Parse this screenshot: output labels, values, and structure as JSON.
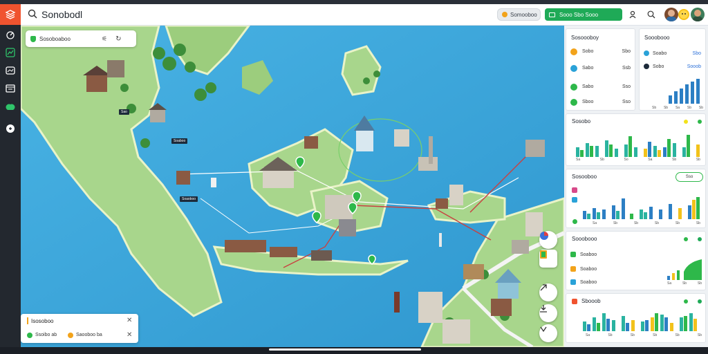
{
  "app": {
    "title": "Sonobodl"
  },
  "topbar": {
    "pill_secondary_label": "Somooboo",
    "pill_primary_label": "Sooo Sbo Sooo"
  },
  "map": {
    "search_placeholder": "Sosoboaboo",
    "card": {
      "title": "Isosoboo",
      "row_1": "Ssoibo ab",
      "row_2": "Saooboo ba"
    },
    "callouts": [
      "Sao",
      "Soaboo",
      "Soaoboo"
    ]
  },
  "panel": {
    "stats_card": {
      "title": "Sosoooboy",
      "rows": [
        {
          "label": "Sobo",
          "value": "Sbo",
          "color": "#f2a31b"
        },
        {
          "label": "Sabo",
          "value": "Ssb",
          "color": "#2aa2d8"
        },
        {
          "label": "Sabo",
          "value": "Sso",
          "color": "#2eb84a"
        },
        {
          "label": "Sboo",
          "value": "Sso",
          "color": "#2eb84a"
        }
      ]
    },
    "summary_card": {
      "title": "Sooobooo",
      "rows": [
        {
          "label": "Soabo",
          "value": "Sbo"
        },
        {
          "label": "Sobo",
          "value": "Sooob"
        }
      ],
      "ticks": [
        "Sb",
        "Sb",
        "Sa",
        "Sb",
        "Sb"
      ]
    },
    "card_3": {
      "title": "Sosobo",
      "ticks": [
        "Sa",
        "Sb",
        "So",
        "Sa",
        "Sb",
        "Sb"
      ]
    },
    "card_4": {
      "title": "Sosooboo",
      "button_label": "Sso",
      "ticks": [
        "Sa",
        "Sb",
        "Sb",
        "Sb",
        "Sb",
        "Sb"
      ]
    },
    "card_5": {
      "title": "Sooobooo",
      "rows": [
        {
          "label": "Soaboo",
          "color": "#2eb84a"
        },
        {
          "label": "Soaboo",
          "color": "#f2a31b"
        },
        {
          "label": "Soaboo",
          "color": "#2aa2d8"
        }
      ],
      "ticks": [
        "Sa",
        "Sb",
        "Sb"
      ]
    },
    "card_6": {
      "title": "Sbooob",
      "ticks": [
        "Sa",
        "Sb",
        "Sb",
        "Sb",
        "Sb",
        "Sb"
      ]
    }
  },
  "colors": {
    "accent": "#f0532f",
    "primary": "#1faa57",
    "water": "#3ea8dc",
    "land": "#a8d68c"
  }
}
